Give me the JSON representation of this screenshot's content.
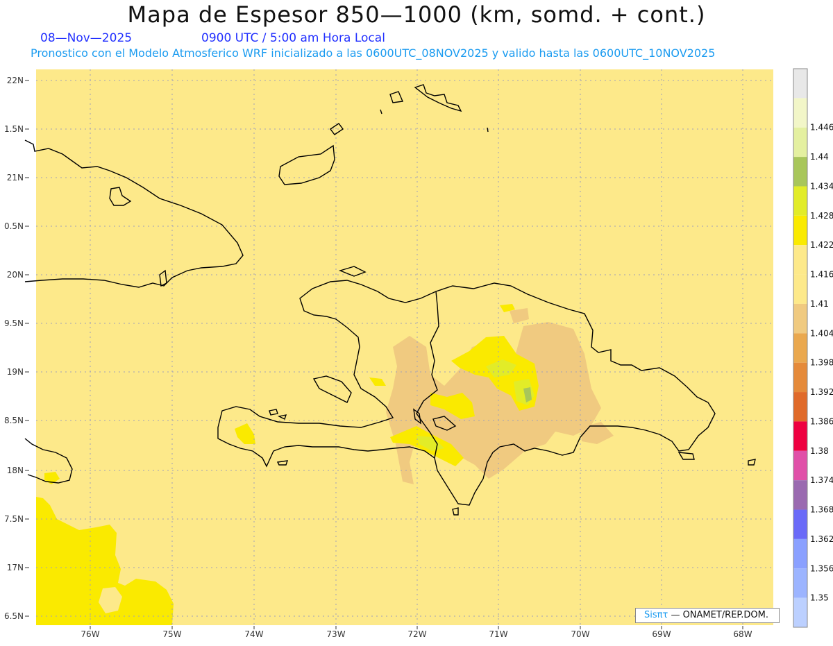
{
  "header": {
    "title": "Mapa de Espesor 850—1000 (km, somd. + cont.)",
    "date": "08—Nov—2025",
    "time": "0900 UTC / 5:00 am Hora Local",
    "subtitle": "Pronostico con el Modelo Atmosferico WRF inicializado a las 0600UTC_08NOV2025 y valido hasta las  0600UTC_10NOV2025"
  },
  "map": {
    "lat_labels": [
      "22N",
      "1.5N",
      "21N",
      "0.5N",
      "20N",
      "9.5N",
      "19N",
      "8.5N",
      "18N",
      "7.5N",
      "17N",
      "6.5N"
    ],
    "lon_labels": [
      "76W",
      "75W",
      "74W",
      "73W",
      "72W",
      "71W",
      "70W",
      "69W",
      "68W"
    ],
    "fill_colors": {
      "base": "#fde98a",
      "low": "#f0ca80",
      "high": "#faea00",
      "higher": "#e2ec28",
      "highest": "#a8c65a"
    }
  },
  "colorbar": {
    "levels": [
      {
        "label": "",
        "color": "#e8e8e8"
      },
      {
        "label": "1.446",
        "color": "#f2f6c8"
      },
      {
        "label": "1.44",
        "color": "#e4f0a0"
      },
      {
        "label": "1.434",
        "color": "#a8c65a"
      },
      {
        "label": "1.428",
        "color": "#e2ec28"
      },
      {
        "label": "1.422",
        "color": "#faea00"
      },
      {
        "label": "1.416",
        "color": "#fde98a"
      },
      {
        "label": "1.41",
        "color": "#fde98a"
      },
      {
        "label": "1.404",
        "color": "#f0ca80"
      },
      {
        "label": "1.398",
        "color": "#eaa84e"
      },
      {
        "label": "1.392",
        "color": "#e58a3a"
      },
      {
        "label": "1.386",
        "color": "#e06a2a"
      },
      {
        "label": "1.38",
        "color": "#ee0040"
      },
      {
        "label": "1.374",
        "color": "#e050a8"
      },
      {
        "label": "1.368",
        "color": "#9a6ab0"
      },
      {
        "label": "1.362",
        "color": "#6a6af8"
      },
      {
        "label": "1.356",
        "color": "#8aa0ff"
      },
      {
        "label": "1.35",
        "color": "#9cb4ff"
      },
      {
        "label": "",
        "color": "#bcd0ff"
      }
    ]
  },
  "credit": {
    "sis": "Sisπτ",
    "org": "— ONAMET/REP.DOM."
  }
}
